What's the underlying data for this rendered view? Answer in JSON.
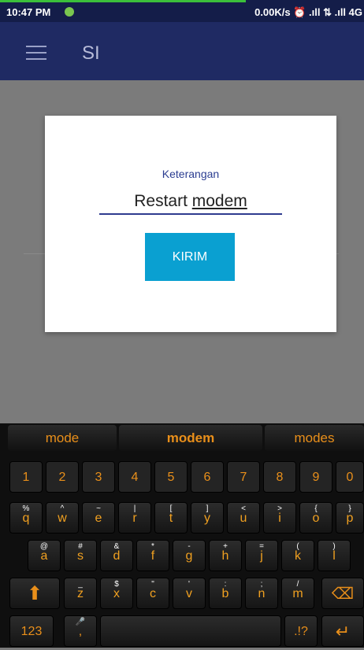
{
  "status_bar": {
    "time": "10:47 PM",
    "right": "0.00K/s ⏰ .ıll ⇅ .ıll 4G"
  },
  "app_bar": {
    "title": "SI"
  },
  "dialog": {
    "label": "Keterangan",
    "value_start": "Restart ",
    "value_underlined": "modem",
    "button": "KIRIM"
  },
  "keyboard": {
    "suggestions": [
      "mode",
      "modem",
      "modes"
    ],
    "num_row": [
      "1",
      "2",
      "3",
      "4",
      "5",
      "6",
      "7",
      "8",
      "9",
      "0"
    ],
    "row1": [
      "q",
      "w",
      "e",
      "r",
      "t",
      "y",
      "u",
      "i",
      "o",
      "p"
    ],
    "row1_sub": [
      "%",
      "^",
      "~",
      "|",
      "[",
      "]",
      "<",
      ">",
      "{",
      "}"
    ],
    "row2": [
      "a",
      "s",
      "d",
      "f",
      "g",
      "h",
      "j",
      "k",
      "l"
    ],
    "row2_sub": [
      "@",
      "#",
      "&",
      "*",
      "-",
      "+",
      "=",
      "(",
      ")"
    ],
    "row3": [
      "z",
      "x",
      "c",
      "v",
      "b",
      "n",
      "m"
    ],
    "row3_sub": [
      "_",
      "$",
      "\"",
      "'",
      ":",
      ";",
      "/"
    ],
    "mode_key": "123",
    "comma": ",",
    "punct": ".!?"
  }
}
